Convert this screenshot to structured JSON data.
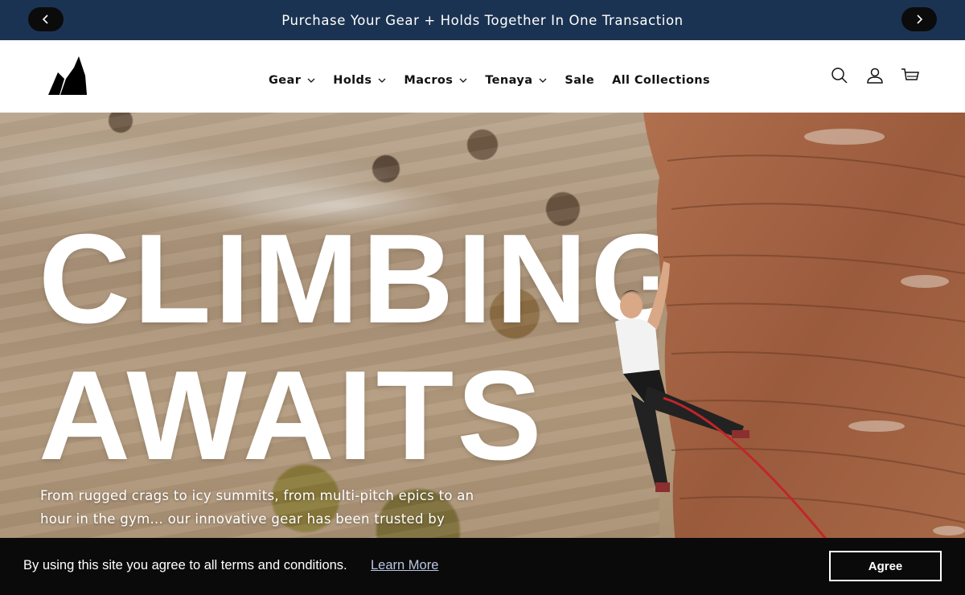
{
  "announcement": {
    "text": "Purchase Your Gear + Holds Together In One Transaction",
    "prev_icon": "chevron-left-icon",
    "next_icon": "chevron-right-icon"
  },
  "header": {
    "nav": [
      {
        "label": "Gear",
        "dropdown": true
      },
      {
        "label": "Holds",
        "dropdown": true
      },
      {
        "label": "Macros",
        "dropdown": true
      },
      {
        "label": "Tenaya",
        "dropdown": true
      },
      {
        "label": "Sale",
        "dropdown": false
      },
      {
        "label": "All Collections",
        "dropdown": false
      }
    ],
    "icons": [
      "search-icon",
      "account-icon",
      "cart-icon"
    ]
  },
  "hero": {
    "headline_line1": "CLIMBING",
    "headline_line2": "AWAITS",
    "description": "From rugged crags to icy summits, from multi-pitch epics to an hour in the gym... our innovative gear has been trusted by"
  },
  "cookie": {
    "message": "By using this site you agree to all terms and conditions.",
    "link": "Learn More",
    "button": "Agree"
  },
  "colors": {
    "announcement_bg": "#1b3352",
    "cookie_bg": "#0a0a0a",
    "text_dark": "#111111"
  }
}
